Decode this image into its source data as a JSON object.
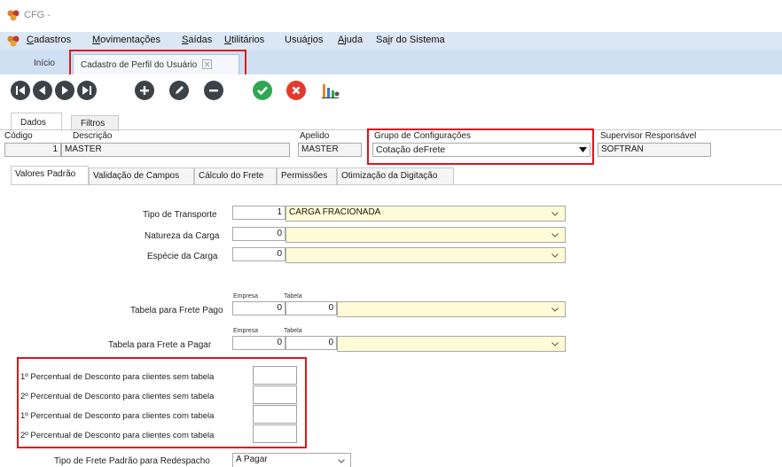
{
  "window": {
    "title": "CFG -"
  },
  "menu": {
    "items": [
      {
        "label_u": "C",
        "label_rest": "adastros"
      },
      {
        "label_u": "M",
        "label_rest": "ovimentações"
      },
      {
        "label_u": "S",
        "label_rest": "aídas"
      },
      {
        "label_u": "U",
        "label_rest": "tilitários"
      },
      {
        "label_pre": "Usuá",
        "label_u": "r",
        "label_rest": "ios"
      },
      {
        "label_u": "A",
        "label_rest": "juda"
      },
      {
        "label_pre": "Sa",
        "label_u": "i",
        "label_rest": "r do Sistema"
      }
    ]
  },
  "doc_tabs": [
    {
      "label": "Início"
    },
    {
      "label": "Cadastro de Perfil do Usuário"
    }
  ],
  "toolbar": {
    "icons": [
      "first-record-icon",
      "previous-record-icon",
      "next-record-icon",
      "last-record-icon",
      "add-icon",
      "edit-icon",
      "remove-icon",
      "confirm-icon",
      "cancel-icon",
      "report-icon"
    ]
  },
  "form_tabs": [
    {
      "label": "Dados"
    },
    {
      "label": "Filtros"
    }
  ],
  "header": {
    "codigo_label": "Código",
    "codigo_value": "1",
    "descricao_label": "Descrição",
    "descricao_value": "MASTER",
    "apelido_label": "Apelido",
    "apelido_value": "MASTER",
    "grupo_label": "Grupo de Configurações",
    "grupo_value": "Cotação deFrete",
    "supervisor_label": "Supervisor Responsável",
    "supervisor_value": "SOFTRAN"
  },
  "sub_tabs": [
    {
      "label": "Valores Padrão"
    },
    {
      "label": "Validação de Campos"
    },
    {
      "label": "Cálculo do Frete"
    },
    {
      "label": "Permissões"
    },
    {
      "label": "Otimização da Digitação"
    }
  ],
  "fields": {
    "tipo_transporte": {
      "label": "Tipo de Transporte",
      "code": "1",
      "value": "CARGA FRACIONADA"
    },
    "natureza_carga": {
      "label": "Natureza da Carga",
      "code": "0",
      "value": ""
    },
    "especie_carga": {
      "label": "Espécie da Carga",
      "code": "0",
      "value": ""
    },
    "frete_pago": {
      "label": "Tabela para Frete Pago",
      "empresa_label": "Empresa",
      "tabela_label": "Tabela",
      "empresa": "0",
      "tabela": "0",
      "value": ""
    },
    "frete_pagar": {
      "label": "Tabela para Frete a Pagar",
      "empresa_label": "Empresa",
      "tabela_label": "Tabela",
      "empresa": "0",
      "tabela": "0",
      "value": ""
    },
    "descontos": [
      {
        "label": "1º Percentual de Desconto para clientes sem tabela",
        "value": ""
      },
      {
        "label": "2º Percentual de Desconto para clientes sem tabela",
        "value": ""
      },
      {
        "label": "1º Percentual de Desconto para clientes com tabela",
        "value": ""
      },
      {
        "label": "2º Percentual de Desconto para clientes com tabela",
        "value": ""
      }
    ],
    "tipo_frete_redespacho": {
      "label": "Tipo de Frete Padrão para Redespacho",
      "value": "A Pagar"
    }
  },
  "colors": {
    "highlight": "#e0141b",
    "menubar": "#dbe7f5",
    "tabstrip": "#cfe0f3",
    "yellow_field": "#fffbd6"
  }
}
